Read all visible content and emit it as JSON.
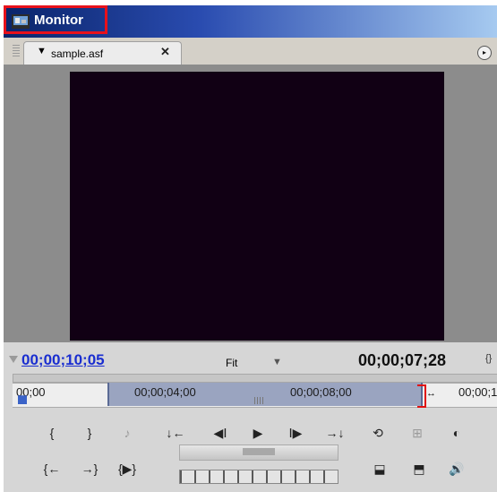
{
  "window": {
    "title": "Monitor",
    "icon": "monitor-app-icon"
  },
  "tab": {
    "label": "sample.asf",
    "close_glyph": "✕",
    "dropdown_glyph": "▼"
  },
  "panel_menu_glyph": "▸",
  "timecodes": {
    "current": "00;00;10;05",
    "duration": "00;00;07;28",
    "zoom": "Fit"
  },
  "ruler": {
    "labels": [
      "00;00",
      "00;00;04;00",
      "00;00;08;00",
      "00;00;1"
    ]
  },
  "controls": {
    "row1": [
      {
        "name": "mark-in-button",
        "icon": "mark-in-icon",
        "glyph": "{"
      },
      {
        "name": "mark-out-button",
        "icon": "mark-out-icon",
        "glyph": "}"
      },
      {
        "name": "set-marker-button",
        "icon": "marker-icon",
        "glyph": "♪"
      },
      {
        "name": "go-to-in-point-button",
        "icon": "go-to-in-icon",
        "glyph": "↓←"
      },
      {
        "name": "step-back-button",
        "icon": "step-back-icon",
        "glyph": "◀Ⅰ"
      },
      {
        "name": "play-button",
        "icon": "play-icon",
        "glyph": "▶"
      },
      {
        "name": "step-forward-button",
        "icon": "step-forward-icon",
        "glyph": "Ⅰ▶"
      },
      {
        "name": "go-to-out-point-button",
        "icon": "go-to-out-icon",
        "glyph": "→↓"
      },
      {
        "name": "loop-button",
        "icon": "loop-icon",
        "glyph": "⟲"
      },
      {
        "name": "safe-margins-button",
        "icon": "safe-margins-icon",
        "glyph": "⊞"
      },
      {
        "name": "output-button",
        "icon": "output-icon",
        "glyph": "◐"
      }
    ],
    "row2": [
      {
        "name": "go-to-previous-marker-button",
        "icon": "prev-marker-icon",
        "glyph": "{←"
      },
      {
        "name": "go-to-next-marker-button",
        "icon": "next-marker-icon",
        "glyph": "→}"
      },
      {
        "name": "play-in-to-out-button",
        "icon": "play-in-out-icon",
        "glyph": "{▶}"
      },
      {
        "name": "insert-button",
        "icon": "insert-icon",
        "glyph": "⬓"
      },
      {
        "name": "overlay-button",
        "icon": "overlay-icon",
        "glyph": "⬒"
      },
      {
        "name": "audio-toggle-button",
        "icon": "speaker-icon",
        "glyph": "🔊"
      }
    ]
  },
  "colors": {
    "title_bar": "#0a246a",
    "highlight": "#e8111b",
    "current_timecode": "#1a2ed0",
    "video_bg": "#110014"
  }
}
